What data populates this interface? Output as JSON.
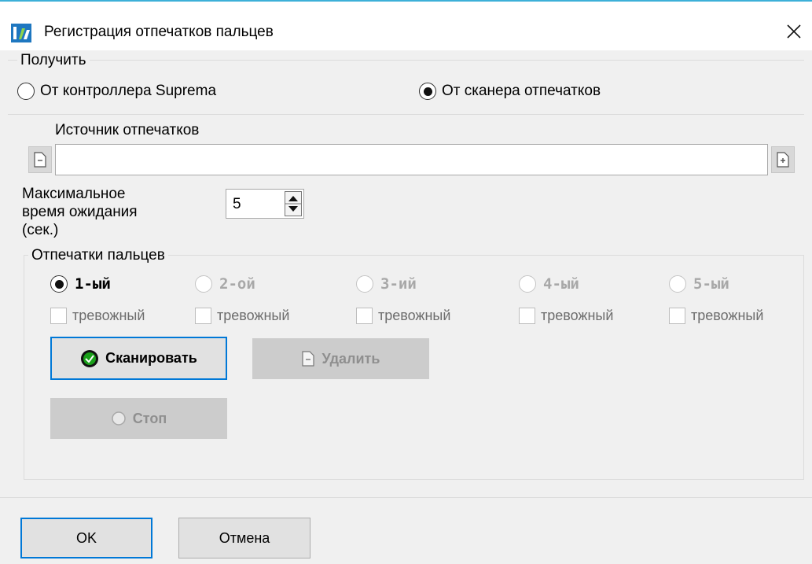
{
  "window": {
    "title": "Регистрация отпечатков пальцев",
    "close_icon": "close-icon",
    "app_icon": "app-logo-icon"
  },
  "receive": {
    "group_label": "Получить",
    "option_controller": "От контроллера Suprema",
    "option_scanner": "От сканера отпечатков",
    "selected": "scanner"
  },
  "source": {
    "label": "Источник отпечатков",
    "value": "",
    "remove_icon": "document-minus-icon",
    "add_icon": "document-plus-icon"
  },
  "timeout": {
    "label_line1": "Максимальное",
    "label_line2": "время ожидания",
    "label_line3": "(сек.)",
    "value": "5"
  },
  "fingerprints": {
    "group_label": "Отпечатки пальцев",
    "slots": [
      {
        "label": "1-ый",
        "selected": true,
        "enabled": true,
        "alarm_label": "тревожный",
        "alarm_checked": false
      },
      {
        "label": "2-ой",
        "selected": false,
        "enabled": false,
        "alarm_label": "тревожный",
        "alarm_checked": false
      },
      {
        "label": "3-ий",
        "selected": false,
        "enabled": false,
        "alarm_label": "тревожный",
        "alarm_checked": false
      },
      {
        "label": "4-ый",
        "selected": false,
        "enabled": false,
        "alarm_label": "тревожный",
        "alarm_checked": false
      },
      {
        "label": "5-ый",
        "selected": false,
        "enabled": false,
        "alarm_label": "тревожный",
        "alarm_checked": false
      }
    ],
    "scan_label": "Сканировать",
    "delete_label": "Удалить",
    "stop_label": "Стоп"
  },
  "footer": {
    "ok_label": "OK",
    "cancel_label": "Отмена"
  },
  "colors": {
    "accent": "#0078d7",
    "title_line": "#3db0d8",
    "scan_icon": "#1aa01a"
  }
}
